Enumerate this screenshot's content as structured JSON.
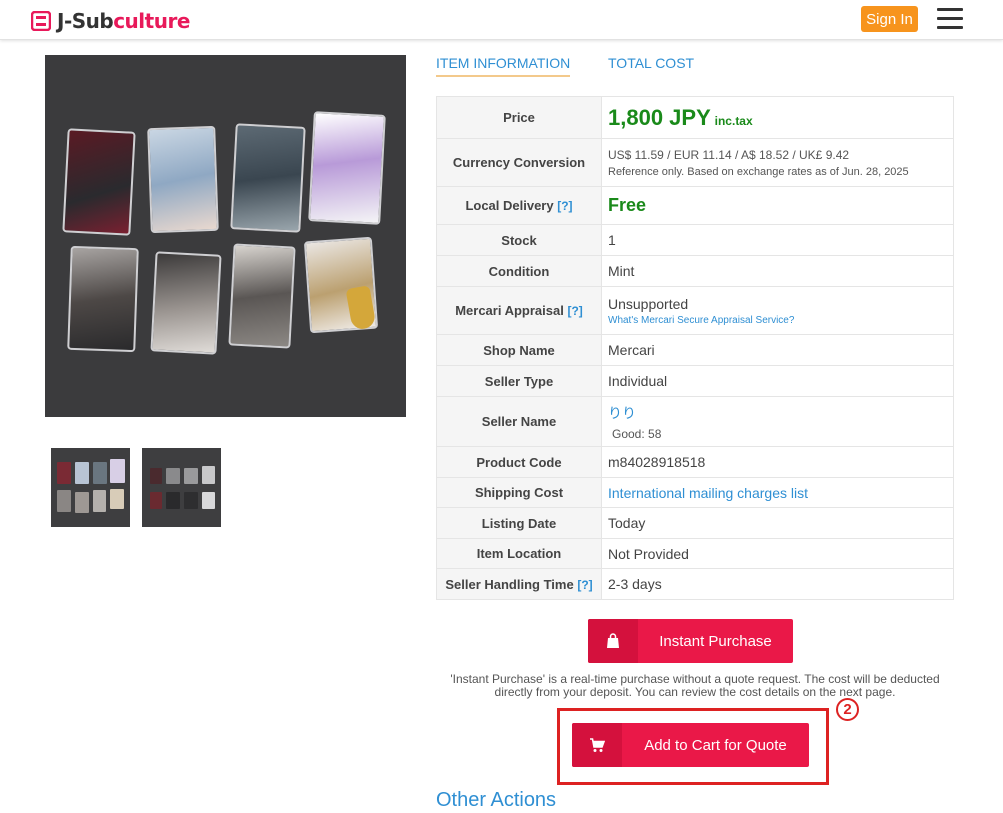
{
  "header": {
    "logo_a": "J-Sub",
    "logo_b": "culture",
    "signin_label": "Sign In",
    "menu_icon": "hamburger-icon"
  },
  "tabs": [
    "ITEM INFORMATION",
    "TOTAL COST"
  ],
  "info": {
    "price_label": "Price",
    "price_value": "1,800 JPY",
    "price_suffix": "inc.tax",
    "currency_label": "Currency Conversion",
    "currency_value": "US$ 11.59 /  EUR 11.14 /  A$ 18.52 /  UK£  9.42",
    "currency_note": "Reference only. Based on exchange rates as of Jun. 28, 2025",
    "delivery_label": "Local Delivery",
    "help_mark": "[?]",
    "delivery_value": "Free",
    "stock_label": "Stock",
    "stock_value": "1",
    "condition_label": "Condition",
    "condition_value": "Mint",
    "appraisal_label": "Mercari Appraisal",
    "appraisal_value": "Unsupported",
    "appraisal_link": "What's Mercari Secure Appraisal Service?",
    "shop_label": "Shop Name",
    "shop_value": "Mercari",
    "seller_type_label": "Seller Type",
    "seller_type_value": "Individual",
    "seller_name_label": "Seller Name",
    "seller_name_value": "りり",
    "seller_rating_label": "Good:",
    "seller_rating_value": "58",
    "code_label": "Product Code",
    "code_value": "m84028918518",
    "shipping_label": "Shipping Cost",
    "shipping_value": "International mailing charges list",
    "listing_label": "Listing Date",
    "listing_value": "Today",
    "location_label": "Item Location",
    "location_value": "Not Provided",
    "handling_label": "Seller Handling Time",
    "handling_value": "2-3 days"
  },
  "actions": {
    "instant_label": "Instant Purchase",
    "instant_icon": "shopping-bag-icon",
    "note": "'Instant Purchase' is a real-time purchase without a quote request. The cost will be deducted directly from your deposit. You can review the cost details on the next page.",
    "cart_label": "Add to Cart for Quote",
    "cart_icon": "shopping-cart-icon",
    "marker": "2",
    "other_actions": "Other Actions"
  },
  "colors": {
    "accent": "#ea1848",
    "link": "#2f8fd3",
    "price": "#1a8a1a",
    "signin": "#f7941d",
    "highlight": "#dd2222"
  }
}
